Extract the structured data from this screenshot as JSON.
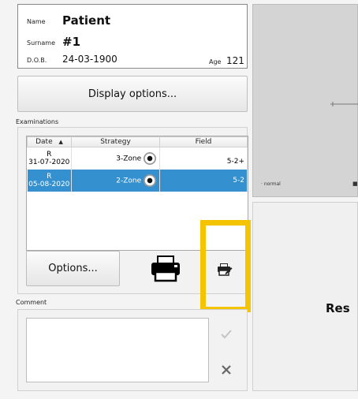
{
  "patient": {
    "name_label": "Name",
    "name_value": "Patient",
    "surname_label": "Surname",
    "surname_value": "#1",
    "dob_label": "D.O.B.",
    "dob_value": "24-03-1900",
    "age_label": "Age",
    "age_value": "121"
  },
  "display_options_label": "Display options...",
  "examinations": {
    "section_label": "Examinations",
    "columns": [
      "Date",
      "Strategy",
      "Field"
    ],
    "rows": [
      {
        "eye": "R",
        "date": "31-07-2020",
        "strategy": "3-Zone",
        "field": "5-2+"
      },
      {
        "eye": "R",
        "date": "05-08-2020",
        "strategy": "2-Zone",
        "field": "5-2"
      }
    ]
  },
  "options_label": "Options...",
  "comment": {
    "section_label": "Comment",
    "value": ""
  },
  "right_panel": {
    "legend_normal": "· normal",
    "result_partial": "Res"
  },
  "icons": {
    "print": "printer-icon",
    "quick_print": "quick-print-icon",
    "confirm": "check-icon",
    "discard": "close-icon"
  },
  "colors": {
    "selection": "#3590cf",
    "highlight": "#f5c400"
  }
}
